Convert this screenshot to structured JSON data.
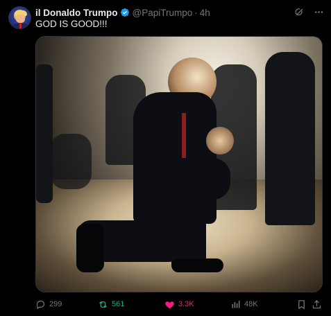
{
  "author": {
    "display_name": "il Donaldo Trumpo",
    "handle": "@PapiTrumpo",
    "separator": "·",
    "time": "4h",
    "verified_color": "#1d9bf0"
  },
  "post": {
    "text": "GOD IS GOOD!!!"
  },
  "header_icons": [
    "grok-icon",
    "more-icon"
  ],
  "actions": {
    "replies": "299",
    "reposts": "561",
    "likes": "3.3K",
    "views": "48K"
  },
  "colors": {
    "background": "#000000",
    "text": "#e7e9ea",
    "muted": "#71767b",
    "repost": "#00ba7c",
    "like": "#f91880"
  }
}
